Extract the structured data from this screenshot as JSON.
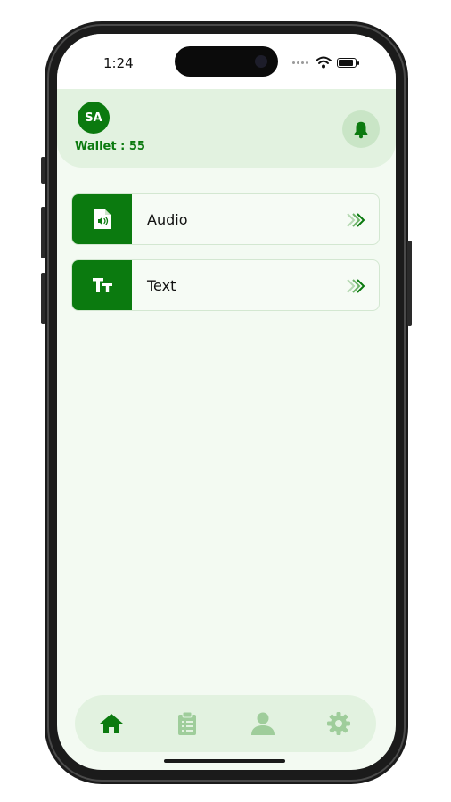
{
  "status_bar": {
    "time": "1:24"
  },
  "header": {
    "avatar_initials": "SA",
    "wallet_text": "Wallet : 55",
    "bell_icon": "bell-icon"
  },
  "options": [
    {
      "label": "Audio",
      "icon": "audio-file-icon"
    },
    {
      "label": "Text",
      "icon": "text-format-icon"
    }
  ],
  "bottom_nav": [
    {
      "icon": "home-icon",
      "active": true
    },
    {
      "icon": "clipboard-icon",
      "active": false
    },
    {
      "icon": "person-icon",
      "active": false
    },
    {
      "icon": "gear-icon",
      "active": false
    }
  ],
  "colors": {
    "primary": "#0b7a0f",
    "header_bg": "#e2f2e0",
    "screen_bg": "#f3faf2",
    "inactive_icon": "#9fcd9b"
  }
}
